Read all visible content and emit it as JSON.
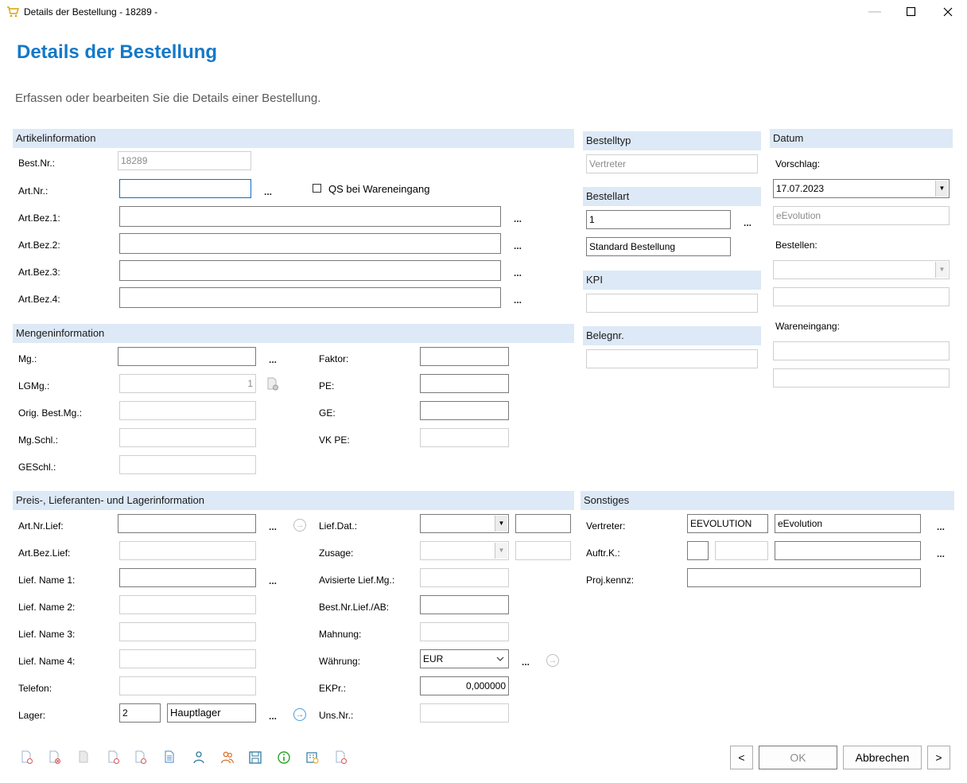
{
  "window": {
    "title": "Details der Bestellung - 18289 -",
    "icon": "cart-icon",
    "controls": [
      "minimize-icon",
      "maximize-icon",
      "close-icon"
    ]
  },
  "header": {
    "title": "Details der Bestellung",
    "subtitle": "Erfassen oder bearbeiten Sie die Details einer Bestellung."
  },
  "artikel": {
    "section": "Artikelinformation",
    "best_nr_label": "Best.Nr.:",
    "best_nr_value": "18289",
    "art_nr_label": "Art.Nr.:",
    "art_nr_value": "",
    "qs_label": "QS bei Wareneingang",
    "qs_checked": false,
    "bez1_label": "Art.Bez.1:",
    "bez2_label": "Art.Bez.2:",
    "bez3_label": "Art.Bez.3:",
    "bez4_label": "Art.Bez.4:",
    "ellipsis": "..."
  },
  "menge": {
    "section": "Mengeninformation",
    "mg_label": "Mg.:",
    "lgmg_label": "LGMg.:",
    "lgmg_value": "1",
    "orig_label": "Orig. Best.Mg.:",
    "mgschl_label": "Mg.Schl.:",
    "geschl_label": "GESchl.:",
    "faktor_label": "Faktor:",
    "pe_label": "PE:",
    "ge_label": "GE:",
    "vkpe_label": "VK PE:"
  },
  "bestelltyp": {
    "section": "Bestelltyp",
    "value": "Vertreter"
  },
  "bestellart": {
    "section": "Bestellart",
    "code": "1",
    "name": "Standard Bestellung"
  },
  "kpi": {
    "section": "KPI",
    "value": ""
  },
  "belegnr": {
    "section": "Belegnr.",
    "value": ""
  },
  "datum": {
    "section": "Datum",
    "vorschlag_label": "Vorschlag:",
    "vorschlag_date": "17.07.2023",
    "vorschlag_user": "eEvolution",
    "bestellen_label": "Bestellen:",
    "wareneingang_label": "Wareneingang:"
  },
  "preis": {
    "section": "Preis-, Lieferanten- und Lagerinformation",
    "artnrlief_label": "Art.Nr.Lief:",
    "artbezlief_label": "Art.Bez.Lief:",
    "liefname1_label": "Lief. Name 1:",
    "liefname2_label": "Lief. Name 2:",
    "liefname3_label": "Lief. Name 3:",
    "liefname4_label": "Lief. Name 4:",
    "telefon_label": "Telefon:",
    "lager_label": "Lager:",
    "lager_code": "2",
    "lager_name": "Hauptlager",
    "liefdat_label": "Lief.Dat.:",
    "zusage_label": "Zusage:",
    "avisiert_label": "Avisierte Lief.Mg.:",
    "bestnrlief_label": "Best.Nr.Lief./AB:",
    "mahnung_label": "Mahnung:",
    "waehrung_label": "Währung:",
    "waehrung_value": "EUR",
    "ekpr_label": "EKPr.:",
    "ekpr_value": "0,000000",
    "unsnr_label": "Uns.Nr.:"
  },
  "sonstiges": {
    "section": "Sonstiges",
    "vertreter_label": "Vertreter:",
    "vertreter_code": "EEVOLUTION",
    "vertreter_name": "eEvolution",
    "auftrk_label": "Auftr.K.:",
    "projkennz_label": "Proj.kennz:"
  },
  "toolbar_icons": [
    "doc-alert-icon",
    "doc-delete-icon",
    "doc-blank-icon",
    "doc-alert-icon",
    "doc-alert-icon",
    "doc-text-icon",
    "person-icon",
    "people-icon",
    "save-icon",
    "info-icon",
    "building-icon",
    "doc-alert-icon"
  ],
  "footer": {
    "prev": "<",
    "ok": "OK",
    "cancel": "Abbrechen",
    "next": ">"
  },
  "colors": {
    "accent": "#1479c8",
    "section_bg": "#dde9f6",
    "focus_border": "#0f6ec8"
  }
}
